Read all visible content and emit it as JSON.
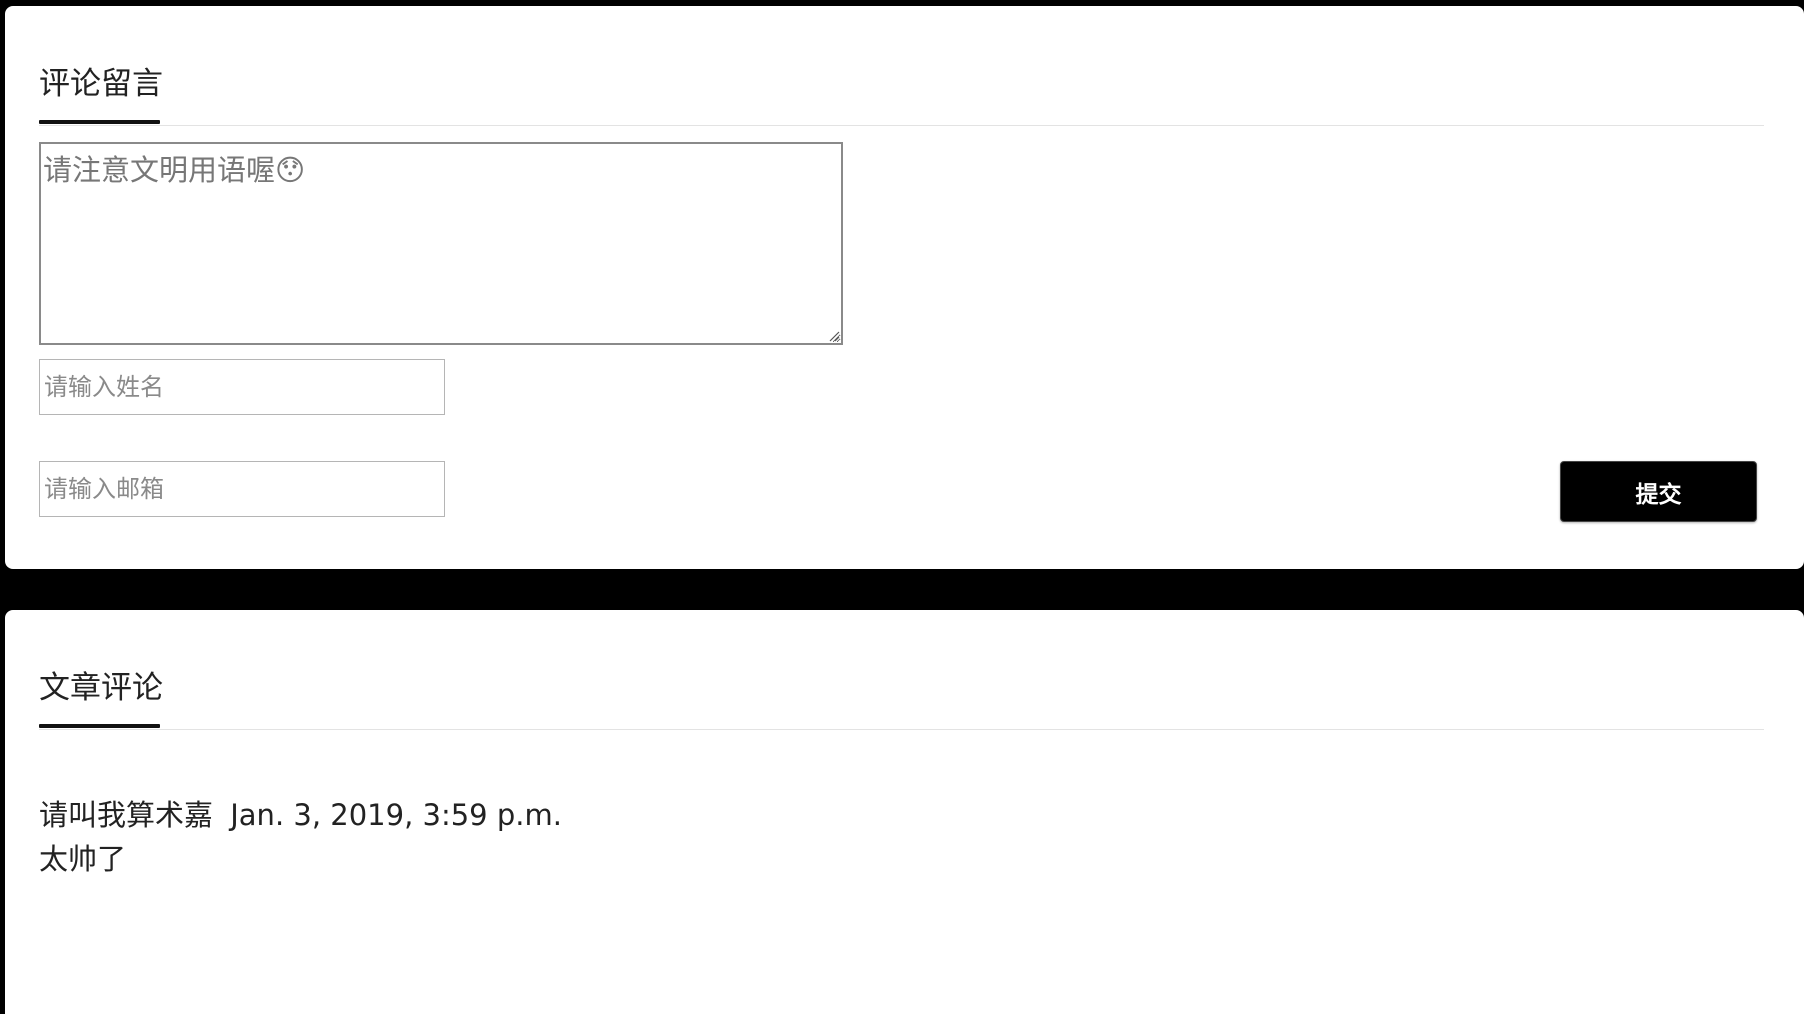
{
  "comment_form": {
    "title": "评论留言",
    "comment_placeholder": "请注意文明用语喔😯",
    "name_placeholder": "请输入姓名",
    "email_placeholder": "请输入邮箱",
    "submit_label": "提交"
  },
  "comments_section": {
    "title": "文章评论",
    "comments": [
      {
        "author": "请叫我算术嘉",
        "date": "Jan. 3, 2019, 3:59 p.m.",
        "body": "太帅了"
      }
    ]
  },
  "colors": {
    "page_background": "#000000",
    "card_background": "#ffffff",
    "button_background": "#000000",
    "button_text": "#ffffff"
  }
}
